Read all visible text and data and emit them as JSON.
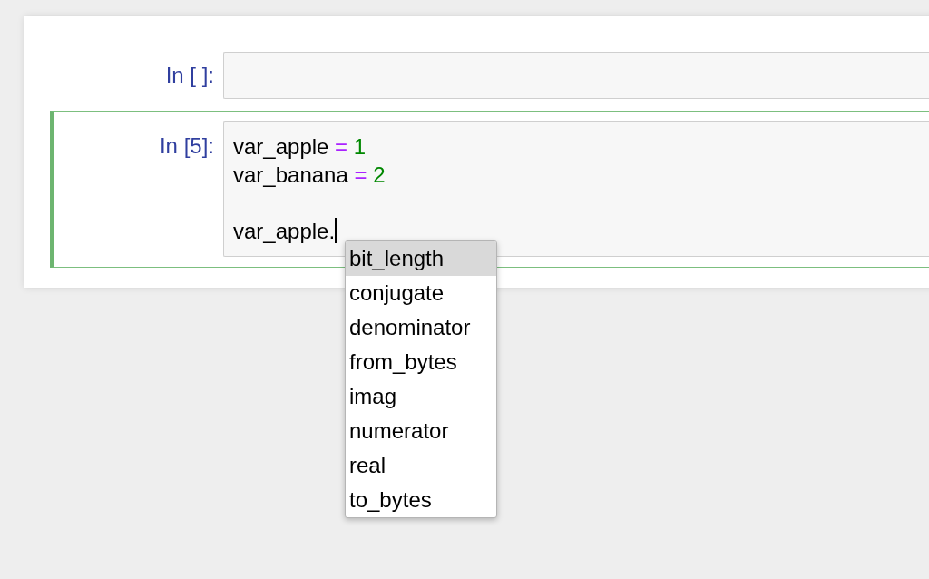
{
  "cells": [
    {
      "prompt": "In [ ]:",
      "selected": false
    },
    {
      "prompt": "In [5]:",
      "selected": true,
      "lines": [
        {
          "kind": "code",
          "tokens": [
            {
              "kind": "name",
              "text": "var_apple"
            },
            {
              "kind": "operator",
              "text": "="
            },
            {
              "kind": "number",
              "text": "1"
            }
          ]
        },
        {
          "kind": "code",
          "tokens": [
            {
              "kind": "name",
              "text": "var_banana"
            },
            {
              "kind": "operator",
              "text": "="
            },
            {
              "kind": "number",
              "text": "2"
            }
          ]
        },
        {
          "kind": "blank"
        },
        {
          "kind": "code",
          "tokens": [
            {
              "kind": "name",
              "text": "var_apple."
            }
          ]
        }
      ],
      "cursor": true
    }
  ],
  "completions": [
    {
      "label": "bit_length",
      "selected": true
    },
    {
      "label": "conjugate",
      "selected": false
    },
    {
      "label": "denominator",
      "selected": false
    },
    {
      "label": "from_bytes",
      "selected": false
    },
    {
      "label": "imag",
      "selected": false
    },
    {
      "label": "numerator",
      "selected": false
    },
    {
      "label": "real",
      "selected": false
    },
    {
      "label": "to_bytes",
      "selected": false
    }
  ]
}
